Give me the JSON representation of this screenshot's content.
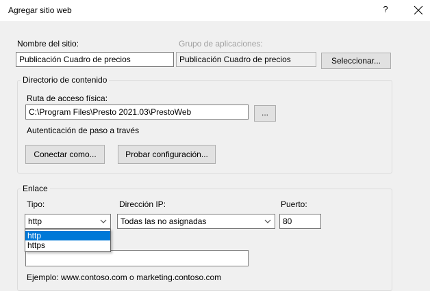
{
  "dialog": {
    "title": "Agregar sitio web",
    "help_label": "?",
    "close_label": "✕"
  },
  "site": {
    "name_label": "Nombre del sitio:",
    "name_value": "Publicación Cuadro de precios",
    "app_pool_label": "Grupo de aplicaciones:",
    "app_pool_value": "Publicación Cuadro de precios",
    "select_button": "Seleccionar..."
  },
  "content_dir": {
    "legend": "Directorio de contenido",
    "path_label": "Ruta de acceso física:",
    "path_value": "C:\\Program Files\\Presto 2021.03\\PrestoWeb",
    "browse_button": "...",
    "passthrough_label": "Autenticación de paso a través",
    "connect_as_button": "Conectar como...",
    "test_settings_button": "Probar configuración..."
  },
  "binding": {
    "legend": "Enlace",
    "type_label": "Tipo:",
    "type_value": "http",
    "type_options": [
      "http",
      "https"
    ],
    "type_selected_index": 0,
    "ip_label": "Dirección IP:",
    "ip_value": "Todas las no asignadas",
    "port_label": "Puerto:",
    "port_value": "80",
    "hostname_value": "",
    "example_text": "Ejemplo: www.contoso.com o marketing.contoso.com"
  },
  "colors": {
    "selection": "#0078d7",
    "window_bg": "#f0f0f0",
    "disabled_text": "#a0a0a0"
  },
  "icons": {
    "close": "close-icon",
    "combo_arrow": "chevron-down-icon"
  }
}
